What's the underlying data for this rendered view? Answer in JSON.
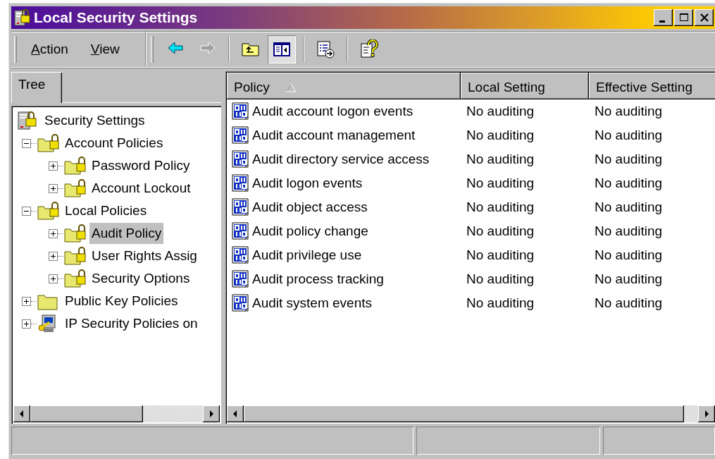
{
  "window": {
    "title": "Local Security Settings"
  },
  "menu": [
    {
      "label": "Action"
    },
    {
      "label": "View"
    }
  ],
  "toolbar": [
    {
      "kind": "back",
      "disabled": false
    },
    {
      "kind": "forward",
      "disabled": true
    },
    {
      "kind": "sep"
    },
    {
      "kind": "up",
      "pressed": false
    },
    {
      "kind": "tree",
      "pressed": true
    },
    {
      "kind": "sep"
    },
    {
      "kind": "export",
      "pressed": false
    },
    {
      "kind": "sep"
    },
    {
      "kind": "help",
      "pressed": false
    }
  ],
  "tabs": [
    {
      "label": "Tree",
      "selected": true
    }
  ],
  "tree": [
    {
      "label": "Security Settings",
      "kind": "server",
      "selected": false,
      "children": [
        {
          "label": "Account Policies",
          "kind": "locked-folder",
          "expanded": true,
          "selected": false,
          "children": [
            {
              "label": "Password Policy",
              "kind": "locked-folder",
              "expanded": false,
              "selected": false
            },
            {
              "label": "Account Lockout",
              "kind": "locked-folder",
              "expanded": false,
              "selected": false
            }
          ]
        },
        {
          "label": "Local Policies",
          "kind": "locked-folder",
          "expanded": true,
          "selected": false,
          "children": [
            {
              "label": "Audit Policy",
              "kind": "locked-folder",
              "expanded": false,
              "selected": true
            },
            {
              "label": "User Rights Assig",
              "kind": "locked-folder",
              "expanded": false,
              "selected": false
            },
            {
              "label": "Security Options",
              "kind": "locked-folder",
              "expanded": false,
              "selected": false
            }
          ]
        },
        {
          "label": "Public Key Policies",
          "kind": "folder",
          "expanded": false,
          "selected": false
        },
        {
          "label": "IP Security Policies on",
          "kind": "ip-security",
          "expanded": false,
          "selected": false
        }
      ]
    }
  ],
  "table": {
    "columns": [
      {
        "label": "Policy",
        "sorted": true
      },
      {
        "label": "Local Setting",
        "sorted": false
      },
      {
        "label": "Effective Setting",
        "sorted": false
      }
    ],
    "rows": [
      {
        "cells": [
          "Audit account logon events",
          "No auditing",
          "No auditing"
        ]
      },
      {
        "cells": [
          "Audit account management",
          "No auditing",
          "No auditing"
        ]
      },
      {
        "cells": [
          "Audit directory service access",
          "No auditing",
          "No auditing"
        ]
      },
      {
        "cells": [
          "Audit logon events",
          "No auditing",
          "No auditing"
        ]
      },
      {
        "cells": [
          "Audit object access",
          "No auditing",
          "No auditing"
        ]
      },
      {
        "cells": [
          "Audit policy change",
          "No auditing",
          "No auditing"
        ]
      },
      {
        "cells": [
          "Audit privilege use",
          "No auditing",
          "No auditing"
        ]
      },
      {
        "cells": [
          "Audit process tracking",
          "No auditing",
          "No auditing"
        ]
      },
      {
        "cells": [
          "Audit system events",
          "No auditing",
          "No auditing"
        ]
      }
    ]
  }
}
